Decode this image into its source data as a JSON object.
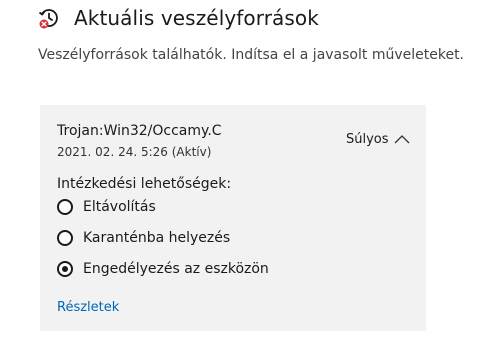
{
  "header": {
    "title": "Aktuális veszélyforrások",
    "icon": "shield-history-icon"
  },
  "subtitle": "Veszélyforrások találhatók. Indítsa el a javasolt műveleteket.",
  "threat": {
    "name": "Trojan:Win32/Occamy.C",
    "date": "2021. 02. 24. 5:26 (Aktív)",
    "severity": "Súlyos",
    "collapse_icon": "chevron-up-icon",
    "options_label": "Intézkedési lehetőségek:",
    "options": [
      {
        "label": "Eltávolítás",
        "selected": false
      },
      {
        "label": "Karanténba helyezés",
        "selected": false
      },
      {
        "label": "Engedélyezés az eszközön",
        "selected": true
      }
    ],
    "details_link": "Részletek"
  },
  "colors": {
    "card_background": "#f2f2f2",
    "link": "#0067b8",
    "alert_red": "#d13438"
  }
}
